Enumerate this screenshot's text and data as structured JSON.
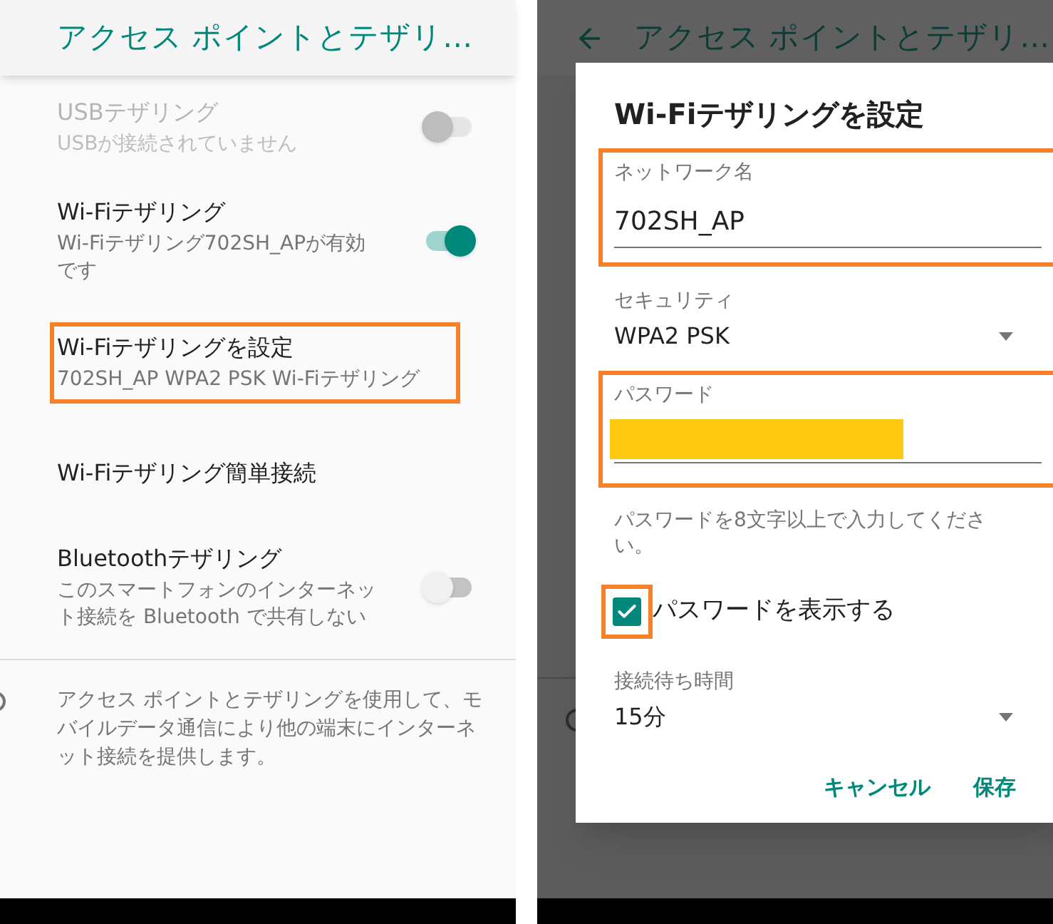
{
  "settings_screen": {
    "app_bar": {
      "title": "アクセス ポイントとテザリ…"
    },
    "items": [
      {
        "kind": "switch",
        "title": "USBテザリング",
        "subtitle": "USBが接続されていません",
        "on": false,
        "disabled": true,
        "highlighted": false
      },
      {
        "kind": "switch",
        "title": "Wi-Fiテザリング",
        "subtitle": "Wi-Fiテザリング702SH_APが有効です",
        "on": true,
        "disabled": false,
        "highlighted": false
      },
      {
        "kind": "link",
        "title": "Wi-Fiテザリングを設定",
        "subtitle": "702SH_AP WPA2 PSK Wi-Fiテザリング",
        "disabled": false,
        "highlighted": true
      },
      {
        "kind": "link",
        "title": "Wi-Fiテザリング簡単接続",
        "disabled": false,
        "highlighted": false
      },
      {
        "kind": "switch",
        "title": "Bluetoothテザリング",
        "subtitle": "このスマートフォンのインターネット接続を Bluetooth で共有しない",
        "on": false,
        "disabled": false,
        "highlighted": false
      }
    ],
    "footer_text": "アクセス ポイントとテザリングを使用して、モバイルデータ通信により他の端末にインターネット接続を提供します。"
  },
  "dialog_screen": {
    "app_bar": {
      "title": "アクセス ポイントとテザリ…"
    },
    "dialog": {
      "title": "Wi-Fiテザリングを設定",
      "network_name": {
        "label": "ネットワーク名",
        "value": "702SH_AP",
        "highlighted": true
      },
      "security": {
        "label": "セキュリティ",
        "value": "WPA2 PSK"
      },
      "password": {
        "label": "パスワード",
        "highlighted": true
      },
      "password_hint": "パスワードを8文字以上で入力してください。",
      "show_password": {
        "label": "パスワードを表示する",
        "checked": true,
        "highlighted": true
      },
      "timeout": {
        "label": "接続待ち時間",
        "value": "15分"
      },
      "buttons": [
        "キャンセル",
        "保存"
      ]
    }
  }
}
